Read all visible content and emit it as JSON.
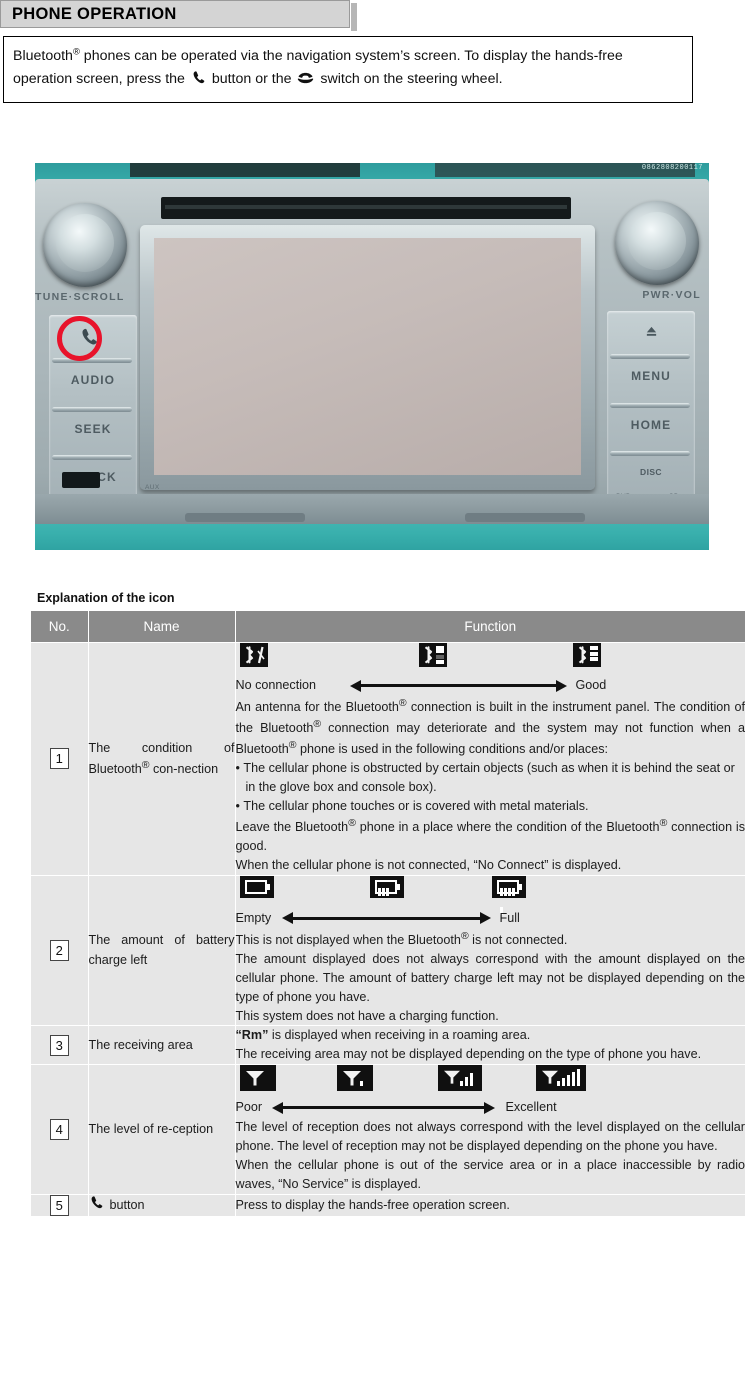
{
  "page": {
    "heading": "PHONE OPERATION",
    "intro": {
      "part1": "Bluetooth",
      "reg1": "®",
      "part2": " phones can be operated via the navigation system’s screen. To display the hands-free operation screen, press the ",
      "glyph_phone": "phone-handset-icon",
      "part3": " button or the ",
      "glyph_steering": "steering-wheel-phone-switch-icon",
      "part4": " switch on the steering wheel."
    }
  },
  "photo": {
    "caption_alt": "head-unit-photo",
    "left_knob_label": "TUNE·SCROLL",
    "right_knob_label": "PWR·VOL",
    "left_buttons": [
      "",
      "AUDIO",
      "SEEK",
      "TRACK"
    ],
    "right_buttons": [
      "▲",
      "MENU",
      "HOME",
      "DISC"
    ],
    "left_button_top_icon": "phone-handset-icon",
    "right_button_top_icon": "eject-icon",
    "bottom_labels": [
      "DVD",
      "CD"
    ],
    "aux_label": "AUX",
    "highlight": "red-circle-highlight"
  },
  "table": {
    "caption": "Explanation of the icon",
    "headers": [
      "No.",
      "Name",
      "Function"
    ],
    "rows": [
      {
        "no": "1",
        "name_html": "The condition of Bluetooth<sup>®</sup> con-nection",
        "icons": [
          "bluetooth-no-connection-icon",
          "bluetooth-medium-icon",
          "bluetooth-good-icon"
        ],
        "scale_left": "No connection",
        "scale_right": "Good",
        "paragraphs": [
          "An antenna for the Bluetooth<sup>®</sup> connection is built in the instrument panel. The condition of the Bluetooth<sup>®</sup> connection may deteriorate and the system may not function when a Bluetooth<sup>®</sup> phone is used in the following conditions and/or places:"
        ],
        "bullets": [
          "The cellular phone is obstructed by certain objects (such as when it is behind the seat or in the glove box and console box).",
          "The cellular phone touches or is covered with metal materials."
        ],
        "paragraphs_after": [
          "Leave the Bluetooth<sup>®</sup> phone in a place where the condition of the Bluetooth<sup>®</sup> connection is good.",
          "When the cellular phone is not connected, “No Connect” is displayed."
        ]
      },
      {
        "no": "2",
        "name_html": "The amount of battery charge left",
        "icons": [
          "battery-empty-icon",
          "battery-half-icon",
          "battery-full-icon"
        ],
        "scale_left": "Empty",
        "scale_right": "Full",
        "paragraphs": [
          "This is not displayed when the Bluetooth<sup>®</sup> is not connected.",
          "The amount displayed does not always correspond with the amount displayed on the cellular phone. The amount of battery charge left may not be displayed depending on the type of phone you have.",
          "This system does not have a charging function."
        ]
      },
      {
        "no": "3",
        "name_html": "The receiving area",
        "icons": [],
        "paragraphs": [
          "<b>“Rm”</b> is displayed when receiving in a roaming area.",
          "The receiving area may not be displayed depending on the type of phone you have."
        ]
      },
      {
        "no": "4",
        "name_html": "The level of re-ception",
        "icons": [
          "signal-level-0-icon",
          "signal-level-1-icon",
          "signal-level-3-icon",
          "signal-level-5-icon"
        ],
        "scale_left": "Poor",
        "scale_right": "Excellent",
        "paragraphs": [
          "The level of reception does not always correspond with the level displayed on the cellular phone. The level of reception may not be displayed depending on the phone you have.",
          "When the cellular phone is out of the service area or in a place inaccessible by radio waves, “No Service” is displayed."
        ]
      },
      {
        "no": "5",
        "name_html": "button",
        "name_icon": "phone-handset-icon",
        "paragraphs": [
          "Press to display the hands-free operation screen."
        ]
      }
    ]
  },
  "colors": {
    "header_gray": "#8a8a8a",
    "row_gray": "#e6e6e6",
    "heading_bar": "#d4d4d4",
    "highlight_red": "#e8132b",
    "icon_black": "#101010"
  }
}
